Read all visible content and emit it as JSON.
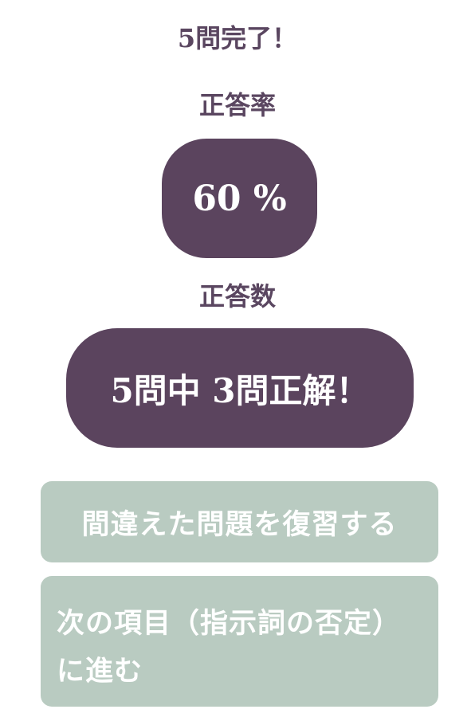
{
  "result": {
    "title": "5問完了！",
    "rate_label": "正答率",
    "rate_value": "60 %",
    "rate_fraction": 0.6,
    "count_label": "正答数",
    "count_value": "5問中 3問正解！",
    "correct": 3,
    "total": 5
  },
  "actions": {
    "review_label": "間違えた問題を復習する",
    "next_label": "次の項目（指示詞の否定）に進む"
  },
  "colors": {
    "accent": "#5b445e",
    "button": "#b9cbc1",
    "text": "#5a4660"
  }
}
